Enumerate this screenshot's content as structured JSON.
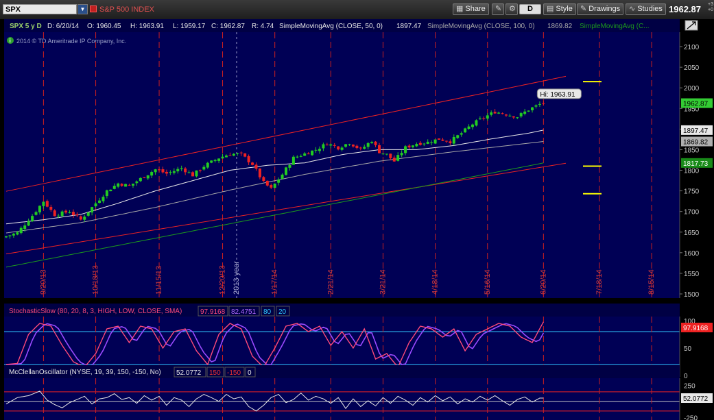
{
  "toolbar": {
    "symbol": "SPX",
    "symbol_name": "S&P 500 INDEX",
    "share_label": "Share",
    "d_label": "D",
    "style_label": "Style",
    "drawings_label": "Drawings",
    "studies_label": "Studies",
    "last_price": "1962.87",
    "change_top": "+3",
    "change_bottom": "+0"
  },
  "header": {
    "period": "SPX 5 y D",
    "date": "D: 6/20/14",
    "open": "O: 1960.45",
    "high": "H: 1963.91",
    "low": "L: 1959.17",
    "close": "C: 1962.87",
    "range": "R: 4.74",
    "sma50_label": "SimpleMovingAvg (CLOSE, 50, 0)",
    "sma50_value": "1897.47",
    "sma100_label": "SimpleMovingAvg (CLOSE, 100, 0)",
    "sma100_value": "1869.82",
    "sma200_label": "SimpleMovingAvg (C...",
    "copyright": "2014 © TD Ameritrade IP Company, Inc.",
    "hi_label": "Hi: 1963.91"
  },
  "colors": {
    "bg": "#000055",
    "up": "#22cc22",
    "down": "#ee2222",
    "sma50": "#e8e8e8",
    "sma100": "#a8a8a8",
    "sma200": "#1c9a1c",
    "channel": "#ee2222",
    "level": "#ffff00",
    "stoch_k": "#ff4a7a",
    "stoch_d": "#9a4aff",
    "stoch_bands": "#30c8ff",
    "mco_line": "#e8e8e8",
    "mco_bands": "#ee2222"
  },
  "chart_data": [
    {
      "type": "candlestick",
      "title": "SPX 5 y D",
      "ylim": [
        1490,
        2130
      ],
      "y_ticks": [
        1500,
        1550,
        1600,
        1650,
        1700,
        1750,
        1800,
        1850,
        1900,
        1950,
        2000,
        2050,
        2100
      ],
      "date_markers": [
        "9/20/13",
        "10/18/13",
        "11/15/13",
        "12/20/13",
        "1/17/14",
        "2/21/14",
        "3/21/14",
        "4/18/14",
        "5/16/14",
        "6/20/14",
        "7/18/14",
        "8/15/14"
      ],
      "year_marker": "2013 year",
      "last_close": 1962.87,
      "high": 1963.91,
      "price_path": [
        [
          0,
          1640
        ],
        [
          3,
          1648
        ],
        [
          7,
          1690
        ],
        [
          10,
          1725
        ],
        [
          13,
          1692
        ],
        [
          17,
          1700
        ],
        [
          20,
          1680
        ],
        [
          23,
          1710
        ],
        [
          27,
          1750
        ],
        [
          30,
          1768
        ],
        [
          33,
          1762
        ],
        [
          37,
          1785
        ],
        [
          40,
          1802
        ],
        [
          43,
          1792
        ],
        [
          47,
          1805
        ],
        [
          50,
          1788
        ],
        [
          53,
          1810
        ],
        [
          57,
          1830
        ],
        [
          60,
          1840
        ],
        [
          63,
          1838
        ],
        [
          66,
          1815
        ],
        [
          69,
          1770
        ],
        [
          71,
          1755
        ],
        [
          74,
          1790
        ],
        [
          77,
          1830
        ],
        [
          80,
          1840
        ],
        [
          83,
          1850
        ],
        [
          86,
          1865
        ],
        [
          89,
          1855
        ],
        [
          92,
          1867
        ],
        [
          95,
          1850
        ],
        [
          98,
          1872
        ],
        [
          100,
          1845
        ],
        [
          102,
          1838
        ],
        [
          104,
          1822
        ],
        [
          107,
          1855
        ],
        [
          110,
          1865
        ],
        [
          113,
          1868
        ],
        [
          116,
          1876
        ],
        [
          119,
          1870
        ],
        [
          122,
          1890
        ],
        [
          125,
          1912
        ],
        [
          128,
          1928
        ],
        [
          131,
          1942
        ],
        [
          134,
          1936
        ],
        [
          137,
          1930
        ],
        [
          140,
          1947
        ],
        [
          143,
          1960
        ],
        [
          144,
          1963
        ]
      ],
      "channel_upper": [
        [
          0,
          1749
        ],
        [
          150,
          2028
        ]
      ],
      "channel_lower": [
        [
          0,
          1597
        ],
        [
          150,
          1817
        ]
      ],
      "sma50": [
        [
          0,
          1670
        ],
        [
          10,
          1680
        ],
        [
          20,
          1693
        ],
        [
          30,
          1720
        ],
        [
          40,
          1750
        ],
        [
          50,
          1775
        ],
        [
          60,
          1800
        ],
        [
          70,
          1812
        ],
        [
          80,
          1818
        ],
        [
          90,
          1838
        ],
        [
          100,
          1850
        ],
        [
          110,
          1850
        ],
        [
          120,
          1860
        ],
        [
          130,
          1876
        ],
        [
          140,
          1890
        ],
        [
          144,
          1897.47
        ]
      ],
      "sma100": [
        [
          0,
          1648
        ],
        [
          20,
          1673
        ],
        [
          40,
          1710
        ],
        [
          60,
          1752
        ],
        [
          80,
          1790
        ],
        [
          100,
          1822
        ],
        [
          120,
          1845
        ],
        [
          144,
          1869.82
        ]
      ],
      "sma200": [
        [
          0,
          1565
        ],
        [
          144,
          1817.73
        ]
      ],
      "levels": [
        2015,
        1810,
        1743
      ],
      "badges": [
        {
          "value": "1962.87",
          "y": 1962.87,
          "bg": "#33cc33",
          "fg": "#000"
        },
        {
          "value": "1897.47",
          "y": 1897.47,
          "bg": "#e8e8e8",
          "fg": "#000"
        },
        {
          "value": "1869.82",
          "y": 1869.82,
          "bg": "#b0b0b0",
          "fg": "#000"
        },
        {
          "value": "1817.73",
          "y": 1817.73,
          "bg": "#188a18",
          "fg": "#fff"
        }
      ]
    },
    {
      "type": "line",
      "title": "StochasticSlow (80, 20, 8, 3, HIGH, LOW, CLOSE, SMA)",
      "series": [
        {
          "name": "FullK",
          "value": "97.9168"
        },
        {
          "name": "FullD",
          "value": "82.4751"
        }
      ],
      "overbought": "80",
      "oversold": "20",
      "ylim": [
        0,
        100
      ],
      "y_ticks": [
        0,
        50,
        100
      ],
      "last_value": "97.9168",
      "k_path": [
        [
          0,
          20
        ],
        [
          3,
          22
        ],
        [
          6,
          75
        ],
        [
          9,
          95
        ],
        [
          12,
          90
        ],
        [
          15,
          55
        ],
        [
          18,
          25
        ],
        [
          21,
          15
        ],
        [
          24,
          40
        ],
        [
          27,
          85
        ],
        [
          30,
          90
        ],
        [
          33,
          60
        ],
        [
          36,
          90
        ],
        [
          39,
          85
        ],
        [
          42,
          50
        ],
        [
          45,
          80
        ],
        [
          48,
          85
        ],
        [
          51,
          45
        ],
        [
          54,
          20
        ],
        [
          57,
          75
        ],
        [
          60,
          95
        ],
        [
          63,
          85
        ],
        [
          66,
          35
        ],
        [
          69,
          15
        ],
        [
          72,
          50
        ],
        [
          75,
          90
        ],
        [
          78,
          95
        ],
        [
          81,
          80
        ],
        [
          84,
          90
        ],
        [
          87,
          55
        ],
        [
          90,
          80
        ],
        [
          93,
          50
        ],
        [
          96,
          85
        ],
        [
          99,
          30
        ],
        [
          102,
          40
        ],
        [
          105,
          15
        ],
        [
          108,
          60
        ],
        [
          111,
          90
        ],
        [
          114,
          85
        ],
        [
          117,
          70
        ],
        [
          120,
          85
        ],
        [
          123,
          45
        ],
        [
          126,
          75
        ],
        [
          129,
          85
        ],
        [
          132,
          95
        ],
        [
          135,
          90
        ],
        [
          138,
          70
        ],
        [
          141,
          60
        ],
        [
          144,
          97.9
        ]
      ]
    },
    {
      "type": "line",
      "title": "McClellanOscillator (NYSE, 19, 39, 150, -150, No)",
      "series": [
        {
          "name": "McClellanOscillator",
          "value": "52.0772"
        }
      ],
      "bands": [
        "150",
        "-150",
        "0"
      ],
      "ylim": [
        -290,
        330
      ],
      "y_ticks": [
        -250,
        250
      ],
      "last_value": "52.0772",
      "path": [
        [
          0,
          -40
        ],
        [
          3,
          60
        ],
        [
          6,
          90
        ],
        [
          9,
          160
        ],
        [
          11,
          20
        ],
        [
          13,
          -50
        ],
        [
          15,
          -100
        ],
        [
          17,
          -20
        ],
        [
          19,
          30
        ],
        [
          21,
          80
        ],
        [
          23,
          -40
        ],
        [
          25,
          40
        ],
        [
          27,
          60
        ],
        [
          29,
          120
        ],
        [
          31,
          30
        ],
        [
          33,
          60
        ],
        [
          35,
          -30
        ],
        [
          37,
          90
        ],
        [
          39,
          20
        ],
        [
          41,
          80
        ],
        [
          43,
          -60
        ],
        [
          45,
          60
        ],
        [
          47,
          20
        ],
        [
          49,
          -80
        ],
        [
          51,
          40
        ],
        [
          53,
          110
        ],
        [
          55,
          60
        ],
        [
          57,
          0
        ],
        [
          59,
          110
        ],
        [
          61,
          40
        ],
        [
          63,
          70
        ],
        [
          65,
          -80
        ],
        [
          67,
          -150
        ],
        [
          69,
          -60
        ],
        [
          71,
          60
        ],
        [
          73,
          110
        ],
        [
          75,
          -20
        ],
        [
          77,
          30
        ],
        [
          79,
          130
        ],
        [
          81,
          20
        ],
        [
          83,
          80
        ],
        [
          85,
          40
        ],
        [
          87,
          -30
        ],
        [
          89,
          60
        ],
        [
          91,
          -110
        ],
        [
          93,
          40
        ],
        [
          95,
          -80
        ],
        [
          97,
          10
        ],
        [
          99,
          -70
        ],
        [
          101,
          60
        ],
        [
          103,
          -30
        ],
        [
          105,
          80
        ],
        [
          107,
          20
        ],
        [
          109,
          -60
        ],
        [
          111,
          60
        ],
        [
          113,
          -10
        ],
        [
          115,
          90
        ],
        [
          117,
          10
        ],
        [
          119,
          70
        ],
        [
          121,
          -40
        ],
        [
          123,
          40
        ],
        [
          125,
          -10
        ],
        [
          127,
          80
        ],
        [
          129,
          20
        ],
        [
          131,
          90
        ],
        [
          133,
          10
        ],
        [
          135,
          -60
        ],
        [
          137,
          30
        ],
        [
          139,
          70
        ],
        [
          141,
          -10
        ],
        [
          143,
          52
        ],
        [
          144,
          52
        ]
      ]
    }
  ]
}
